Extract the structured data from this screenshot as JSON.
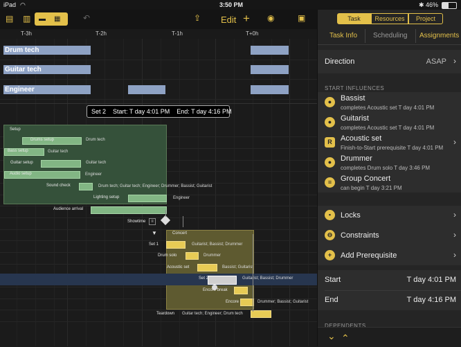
{
  "status": {
    "device": "iPad",
    "time": "3:50 PM",
    "battery": "46%"
  },
  "toolbar": {
    "edit_label": "Edit"
  },
  "timescale": {
    "ticks": [
      "T-3h",
      "T-2h",
      "T-1h",
      "T+0h"
    ]
  },
  "resources": [
    {
      "name": "Drum tech"
    },
    {
      "name": "Guitar tech"
    },
    {
      "name": "Engineer"
    }
  ],
  "tooltip": {
    "text": "Set 2    Start: T day 4:01 PM    End: T day 4:16 PM"
  },
  "tasks": {
    "setup": "Setup",
    "drums_setup": "Drums setup",
    "drums_setup_res": "Drum tech",
    "bass_setup": "Bass setup",
    "bass_setup_res": "Guitar tech",
    "guitar_setup": "Guitar setup",
    "guitar_setup_res": "Guitar tech",
    "audio_setup": "Audio setup",
    "audio_setup_res": "Engineer",
    "sound_check": "Sound check",
    "sound_check_res": "Drum tech; Guitar tech; Engineer; Drummer; Bassist; Guitarist",
    "lighting_setup": "Lighting setup",
    "lighting_setup_res": "Engineer",
    "audience_arrival": "Audience arrival",
    "showtime": "Showtime",
    "concert": "Concert",
    "set1": "Set 1",
    "set1_res": "Guitarist; Bassist; Drummer",
    "drum_solo": "Drum solo",
    "drum_solo_res": "Drummer",
    "acoustic_set": "Acoustic set",
    "acoustic_set_res": "Bassist; Guitarist",
    "set2": "Set 2",
    "set2_res": "Guitarist; Bassist; Drummer",
    "encore_break": "Encore break",
    "encore": "Encore",
    "encore_res": "Drummer; Bassist; Guitarist",
    "teardown": "Teardown",
    "teardown_res": "Guitar tech; Engineer; Drum tech"
  },
  "inspector": {
    "segments": [
      "Task",
      "Resources",
      "Project"
    ],
    "subtabs": [
      "Task Info",
      "Scheduling",
      "Assignments"
    ],
    "direction_label": "Direction",
    "direction_value": "ASAP",
    "start_influences_header": "START INFLUENCES",
    "influences": [
      {
        "name": "Bassist",
        "desc": "completes Acoustic set T day 4:01 PM",
        "icon": "person-icon"
      },
      {
        "name": "Guitarist",
        "desc": "completes Acoustic set T day 4:01 PM",
        "icon": "person-icon"
      },
      {
        "name": "Acoustic set",
        "desc": "Finish-to-Start prerequisite T day 4:01 PM",
        "icon": "task-icon"
      },
      {
        "name": "Drummer",
        "desc": "completes Drum solo T day 3:46 PM",
        "icon": "person-icon"
      },
      {
        "name": "Group Concert",
        "desc": "can begin T day 3:21 PM",
        "icon": "group-icon"
      }
    ],
    "locks_label": "Locks",
    "constraints_label": "Constraints",
    "add_prereq_label": "Add Prerequisite",
    "start_label": "Start",
    "start_value": "T day 4:01 PM",
    "end_label": "End",
    "end_value": "T day 4:16 PM",
    "dependents_header": "DEPENDENTS"
  },
  "colors": {
    "accent": "#e3c04a",
    "task_green": "#82b684",
    "task_gold": "#e7cb55",
    "resource_blue": "#8ea2c4"
  }
}
